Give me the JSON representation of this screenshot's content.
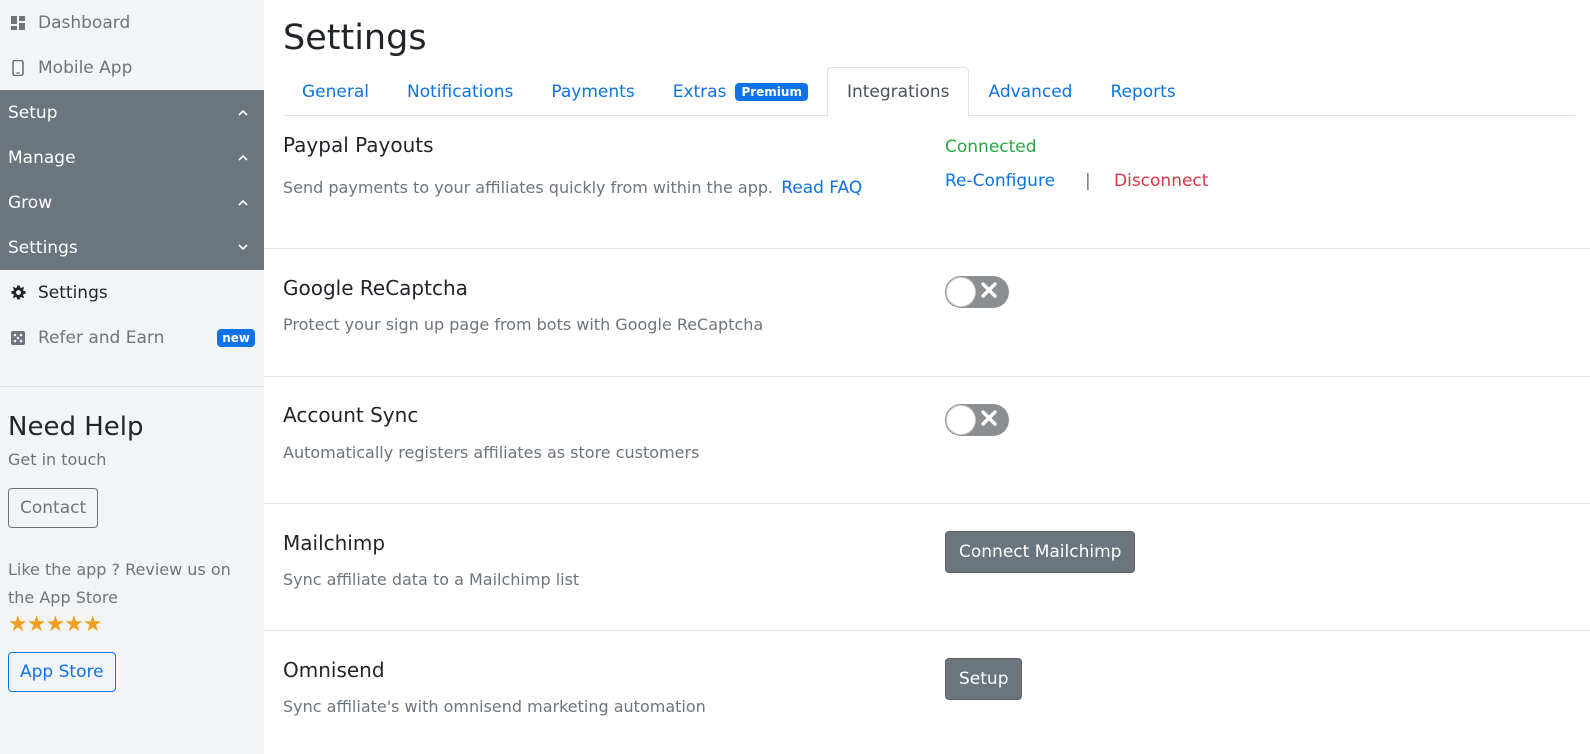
{
  "sidebar": {
    "top_items": [
      {
        "label": "Dashboard",
        "icon": "dashboard-icon"
      },
      {
        "label": "Mobile App",
        "icon": "mobile-phone-icon"
      }
    ],
    "groups": [
      {
        "label": "Setup",
        "state": "expanded"
      },
      {
        "label": "Manage",
        "state": "expanded"
      },
      {
        "label": "Grow",
        "state": "expanded"
      },
      {
        "label": "Settings",
        "state": "collapsed"
      }
    ],
    "sub_items": [
      {
        "label": "Settings",
        "icon": "gear-icon",
        "active": true
      },
      {
        "label": "Refer and Earn",
        "icon": "dice-icon",
        "badge": "new"
      }
    ],
    "help": {
      "title": "Need Help",
      "subtitle": "Get in touch",
      "contact_label": "Contact",
      "review_text": "Like the app ? Review us on the App Store",
      "stars": "★★★★★",
      "rating": 5,
      "app_store_label": "App Store"
    }
  },
  "main": {
    "title": "Settings",
    "tabs": [
      {
        "label": "General"
      },
      {
        "label": "Notifications"
      },
      {
        "label": "Payments"
      },
      {
        "label": "Extras",
        "badge": "Premium"
      },
      {
        "label": "Integrations",
        "active": true
      },
      {
        "label": "Advanced"
      },
      {
        "label": "Reports"
      }
    ],
    "integrations": {
      "paypal": {
        "title": "Paypal Payouts",
        "description": "Send payments to your affiliates quickly from within the app.",
        "faq_link": "Read FAQ",
        "status": "Connected",
        "reconfigure_label": "Re-Configure",
        "separator": "|",
        "disconnect_label": "Disconnect"
      },
      "recaptcha": {
        "title": "Google ReCaptcha",
        "description": "Protect your sign up page from bots with Google ReCaptcha",
        "enabled": false
      },
      "account_sync": {
        "title": "Account Sync",
        "description": "Automatically registers affiliates as store customers",
        "enabled": false
      },
      "mailchimp": {
        "title": "Mailchimp",
        "description": "Sync affiliate data to a Mailchimp list",
        "button_label": "Connect Mailchimp"
      },
      "omnisend": {
        "title": "Omnisend",
        "description": "Sync affiliate's with omnisend marketing automation",
        "button_label": "Setup"
      }
    }
  },
  "colors": {
    "primary": "#0d73e6",
    "secondary": "#6c757d",
    "success": "#28a745",
    "danger": "#dc3545",
    "sidebar_bg": "#f3f4f6"
  }
}
